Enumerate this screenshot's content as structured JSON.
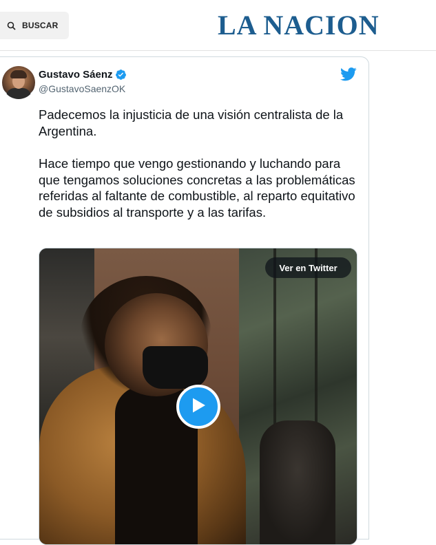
{
  "header": {
    "search_label": "BUSCAR",
    "search_icon": "search-icon",
    "logo_text": "LA NACION",
    "logo_color": "#1d5d8f"
  },
  "tweet": {
    "author_name": "Gustavo Sáenz",
    "author_handle": "@GustavoSaenzOK",
    "verified": true,
    "paragraphs": [
      "Padecemos la injusticia de una visión centralista de la Argentina.",
      "Hace tiempo que vengo gestionando y luchando para que tengamos soluciones concretas a las problemáticas referidas al faltante de combustible, al reparto equitativo de subsidios al transporte y a las tarifas."
    ],
    "media": {
      "view_on_twitter_label": "Ver en Twitter",
      "play_icon": "play-icon"
    },
    "brand_icon": "twitter-bird-icon",
    "accent_color": "#1d9bf0"
  }
}
